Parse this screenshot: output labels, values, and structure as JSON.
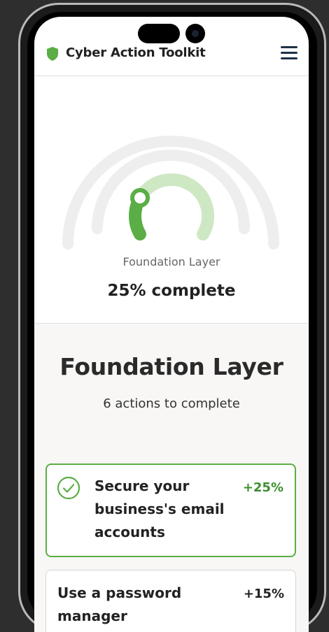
{
  "app": {
    "title": "Cyber Action Toolkit",
    "icons": {
      "logo": "shield-icon",
      "menu": "hamburger-menu-icon"
    },
    "brand_color": "#5aae45"
  },
  "progress": {
    "layer_label": "Foundation Layer",
    "percent_text": "25% complete",
    "percent": 25,
    "colors": {
      "filled": "#5aae45",
      "remaining": "#cfe8c4",
      "track": "#eeeeee"
    }
  },
  "section": {
    "title": "Foundation Layer",
    "subtitle": "6 actions to complete"
  },
  "actions": [
    {
      "label": "Secure your business's email accounts",
      "points": "+25%",
      "state": "selected",
      "icon": "check-circle-icon"
    },
    {
      "label": "Use a password manager",
      "points": "+15%",
      "state": "default"
    }
  ]
}
